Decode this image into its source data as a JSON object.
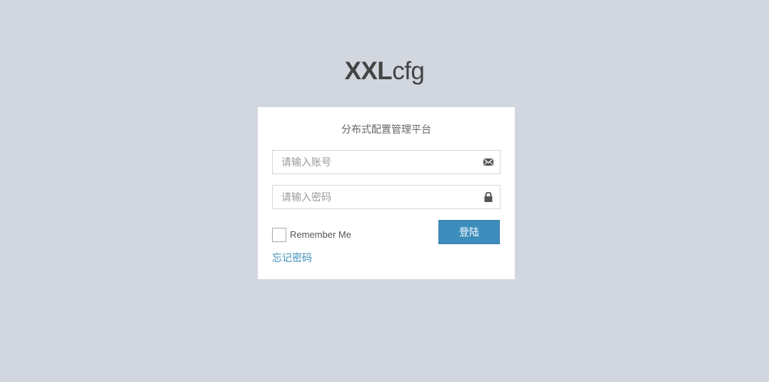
{
  "logo": {
    "bold": "XXL",
    "light": "cfg"
  },
  "login": {
    "subtitle": "分布式配置管理平台",
    "username_placeholder": "请输入账号",
    "username_value": "",
    "username_icon": "envelope-icon",
    "password_placeholder": "请输入密码",
    "password_value": "",
    "password_icon": "lock-icon",
    "remember_label": "Remember Me",
    "remember_checked": false,
    "submit_label": "登陆",
    "forgot_label": "忘记密码"
  },
  "colors": {
    "background": "#d2d6de",
    "accent": "#3c8dbc",
    "card": "#ffffff"
  }
}
